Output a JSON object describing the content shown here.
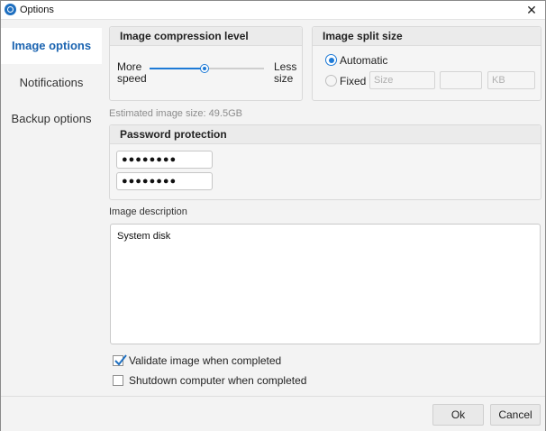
{
  "window": {
    "title": "Options",
    "close_glyph": "✕",
    "app_icon": "app-logo-icon"
  },
  "sidebar": {
    "items": [
      {
        "label": "Image options",
        "active": true
      },
      {
        "label": "Notifications",
        "active": false
      },
      {
        "label": "Backup options",
        "active": false
      }
    ]
  },
  "compression": {
    "title": "Image compression level",
    "left_label_1": "More",
    "left_label_2": "speed",
    "right_label_1": "Less",
    "right_label_2": "size",
    "level_fraction": 0.47,
    "accent_color": "#1e7ad6"
  },
  "split": {
    "title": "Image split size",
    "automatic_label": "Automatic",
    "automatic_selected": true,
    "fixed_label": "Fixed",
    "size_placeholder": "Size",
    "middle_value": "",
    "unit": "KB"
  },
  "estimate": "Estimated image size: 49.5GB",
  "password": {
    "title": "Password protection",
    "field1": "●●●●●●●●",
    "field2": "●●●●●●●●"
  },
  "description": {
    "label": "Image description",
    "value": "System disk"
  },
  "options": {
    "validate_label": "Validate image when completed",
    "validate_checked": true,
    "shutdown_label": "Shutdown computer when completed",
    "shutdown_checked": false
  },
  "footer": {
    "ok_label": "Ok",
    "cancel_label": "Cancel"
  }
}
